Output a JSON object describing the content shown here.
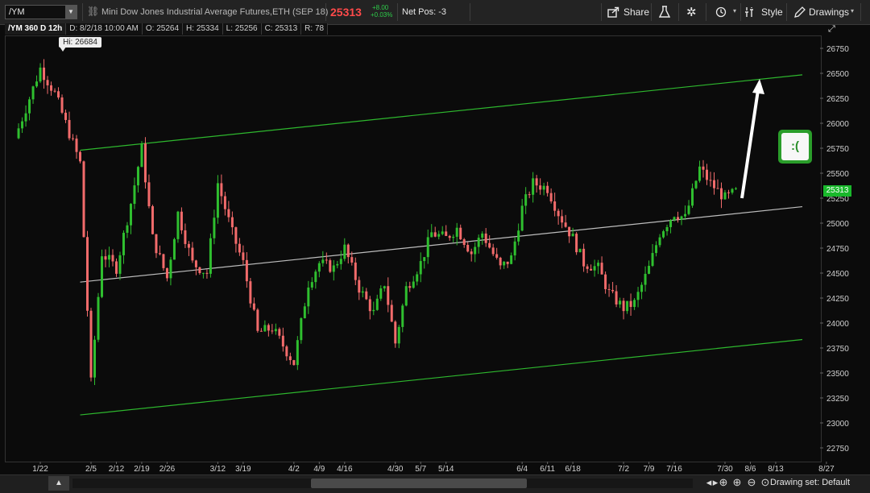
{
  "toolbar": {
    "symbol": "/YM",
    "instrument_title": "Mini Dow Jones Industrial Average Futures,ETH (SEP 18)",
    "last_price": "25313",
    "change_abs": "+8.00",
    "change_pct": "+0.03%",
    "net_pos": "Net Pos: -3",
    "share_label": "Share",
    "style_label": "Style",
    "drawings_label": "Drawings"
  },
  "header": {
    "symbol_period": "/YM 360 D 12h",
    "date": "D: 8/2/18 10:00 AM",
    "open": "O: 25264",
    "high": "H: 25334",
    "low": "L: 25256",
    "close": "C: 25313",
    "range": "R: 78"
  },
  "annotations": {
    "hi_label": "Hi: 26684",
    "current_price_tag": "25313",
    "smiley": ":("
  },
  "bottom": {
    "drawing_set": "Drawing set: Default"
  },
  "colors": {
    "up_candle": "#2fbf2f",
    "down_candle": "#f26b6b",
    "channel_line": "#2eb82e",
    "mid_line": "#bdbdbd",
    "price_tag": "#19b82b",
    "accent_red": "#ff4a4a"
  },
  "chart_data": {
    "type": "line",
    "title": "",
    "xlabel": "",
    "ylabel": "",
    "x_ticks": [
      "1/22",
      "2/5",
      "2/12",
      "2/19",
      "2/26",
      "3/12",
      "3/19",
      "4/2",
      "4/9",
      "4/16",
      "4/30",
      "5/7",
      "5/14",
      "6/4",
      "6/11",
      "6/18",
      "7/2",
      "7/9",
      "7/16",
      "7/30",
      "8/6",
      "8/13",
      "8/27"
    ],
    "y_ticks": [
      22750,
      23000,
      23250,
      23500,
      23750,
      24000,
      24250,
      24500,
      24750,
      25000,
      25250,
      25500,
      25750,
      26000,
      26250,
      26500,
      26750
    ],
    "ylim": [
      22600,
      26900
    ],
    "series": [
      {
        "x": [
          "1/15",
          "1/22",
          "1/26",
          "2/2",
          "2/5",
          "2/8",
          "2/12",
          "2/16",
          "2/19",
          "2/22",
          "2/26",
          "3/1",
          "3/5",
          "3/9",
          "3/12",
          "3/16",
          "3/19",
          "3/23",
          "3/27",
          "4/2",
          "4/6",
          "4/9",
          "4/13",
          "4/16",
          "4/20",
          "4/24",
          "4/27",
          "4/30",
          "5/3",
          "5/7",
          "5/10",
          "5/14",
          "5/17",
          "5/21",
          "5/24",
          "5/29",
          "6/1",
          "6/4",
          "6/7",
          "6/11",
          "6/14",
          "6/18",
          "6/21",
          "6/25",
          "6/28",
          "7/2",
          "7/5",
          "7/9",
          "7/12",
          "7/16",
          "7/19",
          "7/23",
          "7/26",
          "7/30",
          "8/2"
        ],
        "values": [
          25850,
          26550,
          26300,
          25600,
          23400,
          24700,
          24550,
          25200,
          25750,
          24850,
          24450,
          25100,
          24600,
          24500,
          25400,
          24900,
          24600,
          23900,
          23950,
          23600,
          24400,
          24600,
          24550,
          24750,
          24350,
          24100,
          24400,
          23800,
          24350,
          24600,
          24900,
          24850,
          24950,
          24700,
          24900,
          24550,
          24650,
          25150,
          25400,
          25350,
          25100,
          24850,
          24600,
          24550,
          24300,
          24150,
          24200,
          24550,
          24900,
          25100,
          25050,
          25550,
          25400,
          25250,
          25313
        ]
      }
    ],
    "trendlines": [
      {
        "name": "upper channel",
        "from": [
          "2/2",
          25730
        ],
        "to": [
          "8/27",
          26510
        ]
      },
      {
        "name": "middle",
        "from": [
          "2/2",
          24410
        ],
        "to": [
          "8/27",
          25190
        ]
      },
      {
        "name": "lower channel",
        "from": [
          "2/2",
          23080
        ],
        "to": [
          "8/27",
          23860
        ]
      }
    ],
    "grid": false
  }
}
